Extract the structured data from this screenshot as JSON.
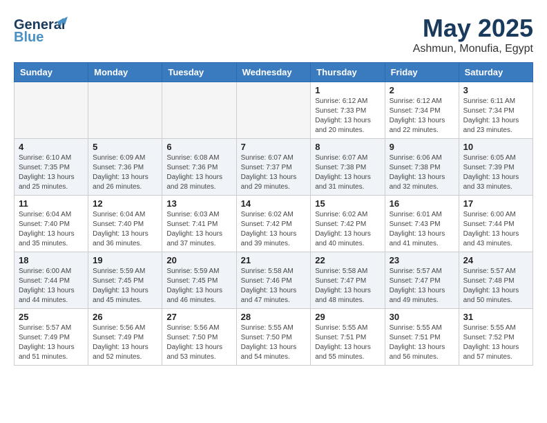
{
  "header": {
    "logo_line1": "General",
    "logo_line2": "Blue",
    "month": "May 2025",
    "location": "Ashmun, Monufia, Egypt"
  },
  "weekdays": [
    "Sunday",
    "Monday",
    "Tuesday",
    "Wednesday",
    "Thursday",
    "Friday",
    "Saturday"
  ],
  "weeks": [
    [
      {
        "day": "",
        "info": ""
      },
      {
        "day": "",
        "info": ""
      },
      {
        "day": "",
        "info": ""
      },
      {
        "day": "",
        "info": ""
      },
      {
        "day": "1",
        "info": "Sunrise: 6:12 AM\nSunset: 7:33 PM\nDaylight: 13 hours\nand 20 minutes."
      },
      {
        "day": "2",
        "info": "Sunrise: 6:12 AM\nSunset: 7:34 PM\nDaylight: 13 hours\nand 22 minutes."
      },
      {
        "day": "3",
        "info": "Sunrise: 6:11 AM\nSunset: 7:34 PM\nDaylight: 13 hours\nand 23 minutes."
      }
    ],
    [
      {
        "day": "4",
        "info": "Sunrise: 6:10 AM\nSunset: 7:35 PM\nDaylight: 13 hours\nand 25 minutes."
      },
      {
        "day": "5",
        "info": "Sunrise: 6:09 AM\nSunset: 7:36 PM\nDaylight: 13 hours\nand 26 minutes."
      },
      {
        "day": "6",
        "info": "Sunrise: 6:08 AM\nSunset: 7:36 PM\nDaylight: 13 hours\nand 28 minutes."
      },
      {
        "day": "7",
        "info": "Sunrise: 6:07 AM\nSunset: 7:37 PM\nDaylight: 13 hours\nand 29 minutes."
      },
      {
        "day": "8",
        "info": "Sunrise: 6:07 AM\nSunset: 7:38 PM\nDaylight: 13 hours\nand 31 minutes."
      },
      {
        "day": "9",
        "info": "Sunrise: 6:06 AM\nSunset: 7:38 PM\nDaylight: 13 hours\nand 32 minutes."
      },
      {
        "day": "10",
        "info": "Sunrise: 6:05 AM\nSunset: 7:39 PM\nDaylight: 13 hours\nand 33 minutes."
      }
    ],
    [
      {
        "day": "11",
        "info": "Sunrise: 6:04 AM\nSunset: 7:40 PM\nDaylight: 13 hours\nand 35 minutes."
      },
      {
        "day": "12",
        "info": "Sunrise: 6:04 AM\nSunset: 7:40 PM\nDaylight: 13 hours\nand 36 minutes."
      },
      {
        "day": "13",
        "info": "Sunrise: 6:03 AM\nSunset: 7:41 PM\nDaylight: 13 hours\nand 37 minutes."
      },
      {
        "day": "14",
        "info": "Sunrise: 6:02 AM\nSunset: 7:42 PM\nDaylight: 13 hours\nand 39 minutes."
      },
      {
        "day": "15",
        "info": "Sunrise: 6:02 AM\nSunset: 7:42 PM\nDaylight: 13 hours\nand 40 minutes."
      },
      {
        "day": "16",
        "info": "Sunrise: 6:01 AM\nSunset: 7:43 PM\nDaylight: 13 hours\nand 41 minutes."
      },
      {
        "day": "17",
        "info": "Sunrise: 6:00 AM\nSunset: 7:44 PM\nDaylight: 13 hours\nand 43 minutes."
      }
    ],
    [
      {
        "day": "18",
        "info": "Sunrise: 6:00 AM\nSunset: 7:44 PM\nDaylight: 13 hours\nand 44 minutes."
      },
      {
        "day": "19",
        "info": "Sunrise: 5:59 AM\nSunset: 7:45 PM\nDaylight: 13 hours\nand 45 minutes."
      },
      {
        "day": "20",
        "info": "Sunrise: 5:59 AM\nSunset: 7:45 PM\nDaylight: 13 hours\nand 46 minutes."
      },
      {
        "day": "21",
        "info": "Sunrise: 5:58 AM\nSunset: 7:46 PM\nDaylight: 13 hours\nand 47 minutes."
      },
      {
        "day": "22",
        "info": "Sunrise: 5:58 AM\nSunset: 7:47 PM\nDaylight: 13 hours\nand 48 minutes."
      },
      {
        "day": "23",
        "info": "Sunrise: 5:57 AM\nSunset: 7:47 PM\nDaylight: 13 hours\nand 49 minutes."
      },
      {
        "day": "24",
        "info": "Sunrise: 5:57 AM\nSunset: 7:48 PM\nDaylight: 13 hours\nand 50 minutes."
      }
    ],
    [
      {
        "day": "25",
        "info": "Sunrise: 5:57 AM\nSunset: 7:49 PM\nDaylight: 13 hours\nand 51 minutes."
      },
      {
        "day": "26",
        "info": "Sunrise: 5:56 AM\nSunset: 7:49 PM\nDaylight: 13 hours\nand 52 minutes."
      },
      {
        "day": "27",
        "info": "Sunrise: 5:56 AM\nSunset: 7:50 PM\nDaylight: 13 hours\nand 53 minutes."
      },
      {
        "day": "28",
        "info": "Sunrise: 5:55 AM\nSunset: 7:50 PM\nDaylight: 13 hours\nand 54 minutes."
      },
      {
        "day": "29",
        "info": "Sunrise: 5:55 AM\nSunset: 7:51 PM\nDaylight: 13 hours\nand 55 minutes."
      },
      {
        "day": "30",
        "info": "Sunrise: 5:55 AM\nSunset: 7:51 PM\nDaylight: 13 hours\nand 56 minutes."
      },
      {
        "day": "31",
        "info": "Sunrise: 5:55 AM\nSunset: 7:52 PM\nDaylight: 13 hours\nand 57 minutes."
      }
    ]
  ]
}
